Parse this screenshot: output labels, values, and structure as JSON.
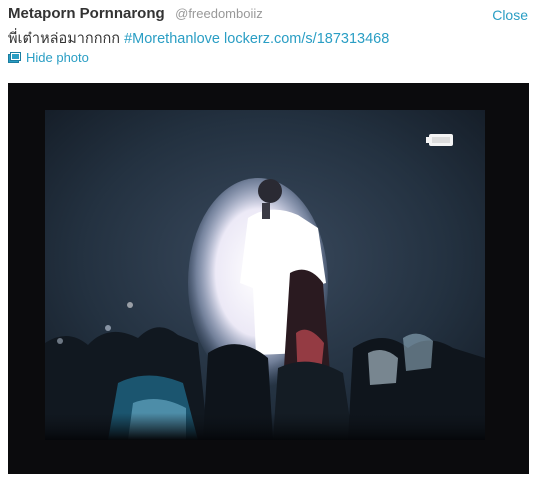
{
  "tweet": {
    "author_name": "Metaporn Pornnarong",
    "author_handle": "@freedomboiiz",
    "close_label": "Close",
    "text": "พี่เต๋าหล่อมากกกก",
    "hashtag": "#Morethanlove",
    "link": "lockerz.com/s/187313468",
    "hide_photo_label": "Hide photo"
  },
  "colors": {
    "link": "#2a9ec4",
    "name": "#333333",
    "handle": "#999999"
  },
  "icons": {
    "hide_photo": "photo-icon"
  }
}
